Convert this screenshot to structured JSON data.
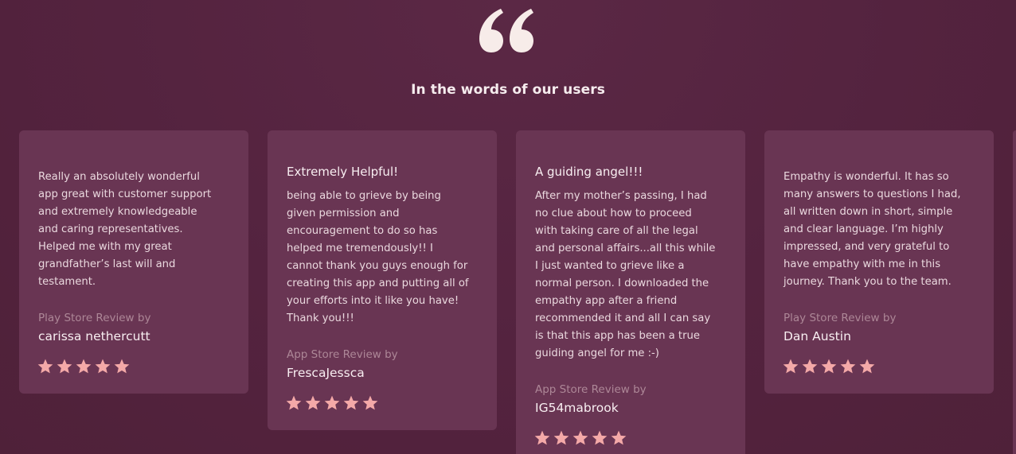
{
  "section": {
    "heading": "In the words of our users",
    "quote_icon": "quote-mark-icon"
  },
  "colors": {
    "background": "#54233f",
    "card": "#693553",
    "star": "#f4a9a8",
    "quote_mark": "#f7ece9"
  },
  "reviews": [
    {
      "title": "",
      "body": "Really an absolutely wonderful\napp great with customer support\nand extremely knowledgeable\nand caring representatives.\nHelped me with my great\ngrandfather’s last will and\ntestament.",
      "source": "Play Store Review by",
      "author": "carissa nethercutt",
      "rating": 5
    },
    {
      "title": "Extremely Helpful!",
      "body": "being able to grieve by being\ngiven permission and\nencouragement to do so has\nhelped me tremendously!! I\ncannot thank you guys enough for\ncreating this app and putting all of\nyour efforts into it like you have!\nThank you!!!",
      "source": "App Store Review by",
      "author": "FrescaJessca",
      "rating": 5
    },
    {
      "title": "A guiding angel!!!",
      "body": "After my mother’s passing, I had\nno clue about how to proceed\nwith taking care of all the legal\nand personal affairs...all this while\nI just wanted to grieve like a\nnormal person. I downloaded the\nempathy app after a friend\nrecommended it and all I can say\nis that this app has been a true\nguiding angel for me :-)",
      "source": "App Store Review by",
      "author": "IG54mabrook",
      "rating": 5
    },
    {
      "title": "",
      "body": "Empathy is wonderful. It has so\nmany answers to questions I had,\nall written down in short, simple\nand clear language. I’m highly\nimpressed, and very grateful to\nhave empathy with me in this\njourney. Thank you to the team.",
      "source": "Play Store Review by",
      "author": "Dan Austin",
      "rating": 5
    }
  ]
}
